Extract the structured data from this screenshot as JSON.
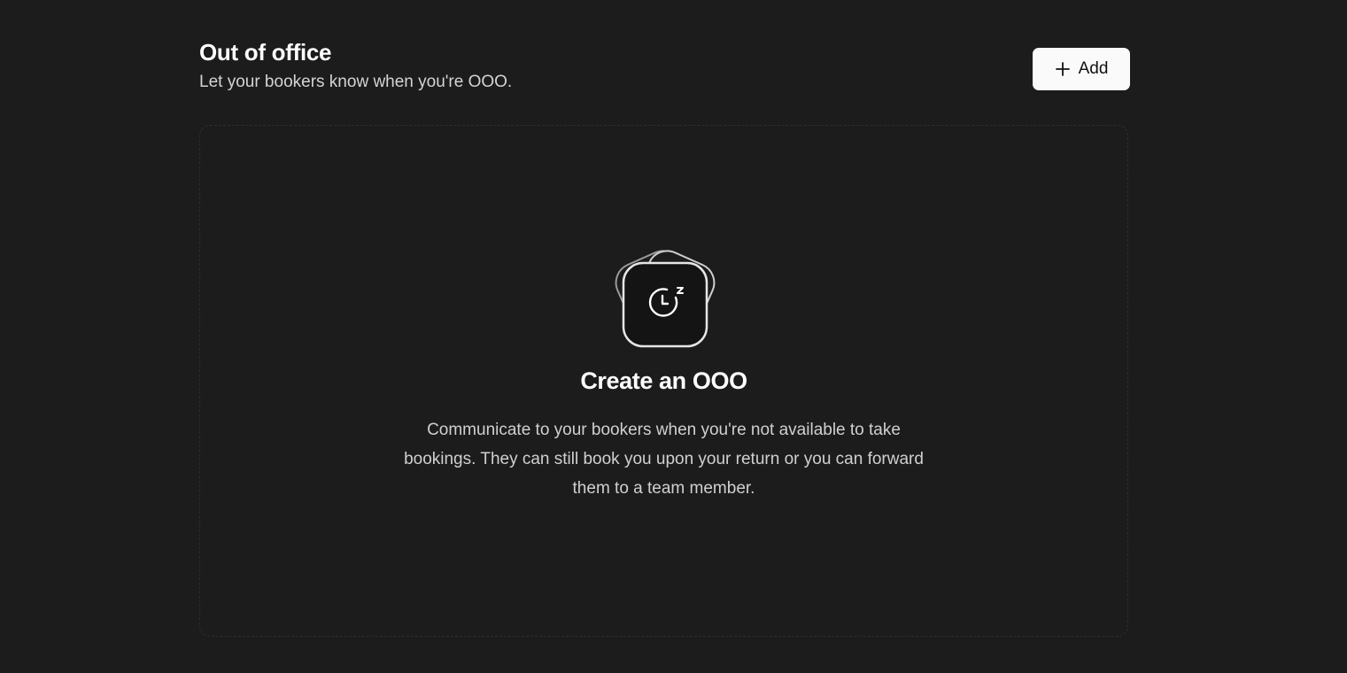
{
  "header": {
    "title": "Out of office",
    "subtitle": "Let your bookers know when you're OOO.",
    "add_button_label": "Add",
    "add_button_icon": "plus-icon"
  },
  "empty_state": {
    "icon": "clock-snooze-icon",
    "title": "Create an OOO",
    "description": "Communicate to your bookers when you're not available to take bookings. They can still book you upon your return or you can forward them to a team member."
  },
  "colors": {
    "background": "#1c1c1c",
    "button_bg": "#fafafa",
    "button_text": "#111111",
    "text_primary": "#ffffff",
    "text_secondary": "#d4d4d4"
  }
}
